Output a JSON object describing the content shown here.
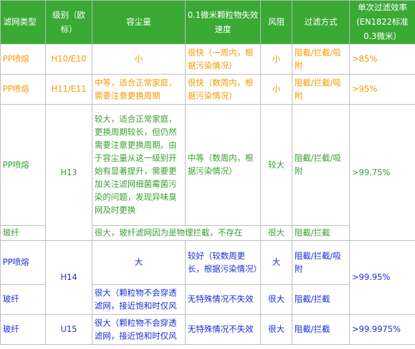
{
  "headers": [
    "滤网类型",
    "级别（欧标）",
    "容尘量",
    "0.1微米颗粒物失效速度",
    "风阻",
    "过滤方式",
    "单次过滤效率(EN1822标准0.3微米）"
  ],
  "rows": {
    "r1": {
      "type": "PP喷熔",
      "grade": "H10/E10",
      "capacity": "小",
      "failure": "很快（一周内，根据污染情况）",
      "resistance": "小",
      "method": "阻截/拦截/吸附",
      "efficiency": ">85%"
    },
    "r2": {
      "type": "PP喷熔",
      "grade": "H11/E11",
      "capacity": "中等，适合正常家庭，需要注意更换周期",
      "failure": "很快（数周内，根据污染情况）",
      "resistance": "小",
      "method": "阻截/拦截/吸附",
      "efficiency": ">95%"
    },
    "r3": {
      "type": "PP喷熔",
      "grade": "H13",
      "capacity": "较大，适合正常家庭，更换周期较长，但仍然需要注意更换周期。由于容尘量从这一级别开始有显著提升，需要更加关注滤网细菌霉菌污染的问题，发现异味臭网及时更换",
      "failure": "中等（数周内，根据污染情况）",
      "resistance": "较大",
      "method": "阻截/拦截/吸附",
      "efficiency": ">99.75%"
    },
    "r4": {
      "type": "玻纤",
      "capacity_failure": "很大，玻纤滤网因为是物理拦截，不存在",
      "resistance": "很大",
      "method": "阻截/拦截"
    },
    "r5": {
      "type": "PP喷熔",
      "grade": "H14",
      "capacity": "大",
      "failure": "较好（较数周更长，根据污染情况）",
      "resistance": "大",
      "method": "阻截/拦截/吸附",
      "efficiency": ">99.95%"
    },
    "r6": {
      "type": "玻纤",
      "capacity": "很大（颗粒物不会穿透滤网，接近饱和时仅风",
      "failure": "无特殊情况不失效",
      "resistance": "很大",
      "method": "阻截/拦截"
    },
    "r7": {
      "type": "玻纤",
      "grade": "U15",
      "capacity": "很大（颗粒物不会穿透滤网，接近饱和时仅风",
      "failure": "无特殊情况不失效",
      "resistance": "很大",
      "method": "阻截/拦截",
      "efficiency": ">99.9975%"
    }
  },
  "colors": {
    "header_bg": "#3aaa35",
    "orange": "#f59a00",
    "green": "#38a02e",
    "blue": "#1a2fd6"
  }
}
